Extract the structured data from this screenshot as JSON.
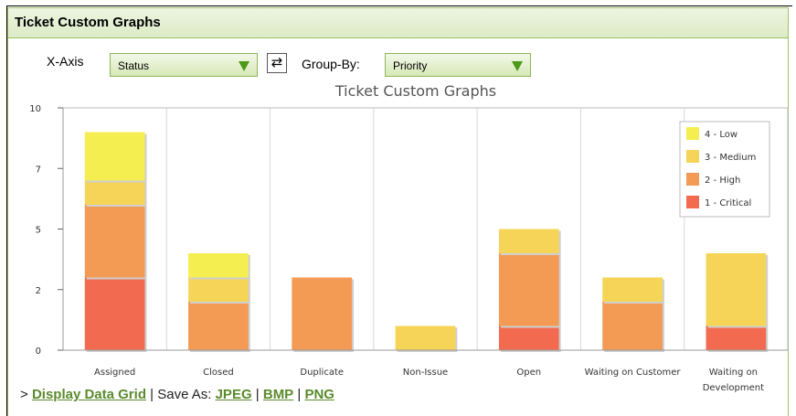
{
  "panel": {
    "title": "Ticket Custom Graphs"
  },
  "controls": {
    "x_axis_label": "X-Axis",
    "x_axis_value": "Status",
    "group_by_label": "Group-By:",
    "group_by_value": "Priority",
    "swap_icon": "swap-arrows-icon"
  },
  "footer": {
    "prefix": "> ",
    "display_grid": "Display Data Grid",
    "save_as": " | Save As: ",
    "jpeg": "JPEG",
    "sep1": " | ",
    "bmp": "BMP",
    "sep2": " | ",
    "png": "PNG"
  },
  "chart_data": {
    "type": "bar",
    "stacked": true,
    "title": "Ticket Custom Graphs",
    "categories": [
      "Assigned",
      "Closed",
      "Duplicate",
      "Non-Issue",
      "Open",
      "Waiting on Customer",
      "Waiting on Development"
    ],
    "y_ticks": [
      "0",
      "2",
      "5",
      "7",
      "10"
    ],
    "y_tick_values": [
      0,
      2.5,
      5,
      7.5,
      10
    ],
    "ylim": [
      0,
      10
    ],
    "grid": true,
    "legend_position": "top-right",
    "series": [
      {
        "name": "1 - Critical",
        "color": "#f26b50",
        "values": [
          3,
          0,
          0,
          0,
          1,
          0,
          1
        ]
      },
      {
        "name": "2 - High",
        "color": "#f39a55",
        "values": [
          3,
          2,
          3,
          0,
          3,
          2,
          0
        ]
      },
      {
        "name": "3 - Medium",
        "color": "#f6d457",
        "values": [
          1,
          1,
          0,
          1,
          1,
          1,
          3
        ]
      },
      {
        "name": "4 - Low",
        "color": "#f5ee50",
        "values": [
          2,
          1,
          0,
          0,
          0,
          0,
          0
        ]
      }
    ]
  }
}
